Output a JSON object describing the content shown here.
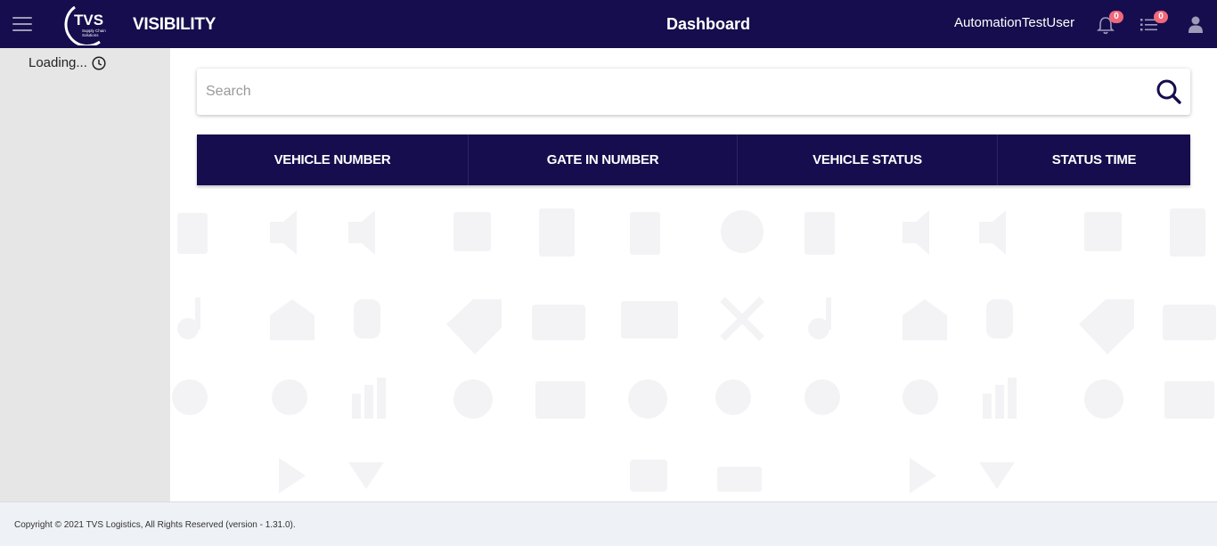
{
  "header": {
    "logo_text": "TVS",
    "logo_subtext": "Supply Chain Solutions",
    "app_title": "VISIBILITY",
    "page_title": "Dashboard",
    "username": "AutomationTestUser",
    "notifications_count": "0",
    "tasks_count": "0"
  },
  "sidebar": {
    "loading_text": "Loading..."
  },
  "search": {
    "placeholder": "Search",
    "value": ""
  },
  "table": {
    "columns": [
      "VEHICLE NUMBER",
      "GATE IN NUMBER",
      "VEHICLE STATUS",
      "STATUS TIME"
    ],
    "rows": []
  },
  "footer": {
    "copyright": "Copyright © 2021 TVS Logistics, All Rights Reserved (version - 1.31.0)."
  },
  "colors": {
    "primary": "#150d4d",
    "badge": "#f0687a",
    "sidebar_bg": "#e6e6e6",
    "footer_bg": "#eef1f5"
  }
}
